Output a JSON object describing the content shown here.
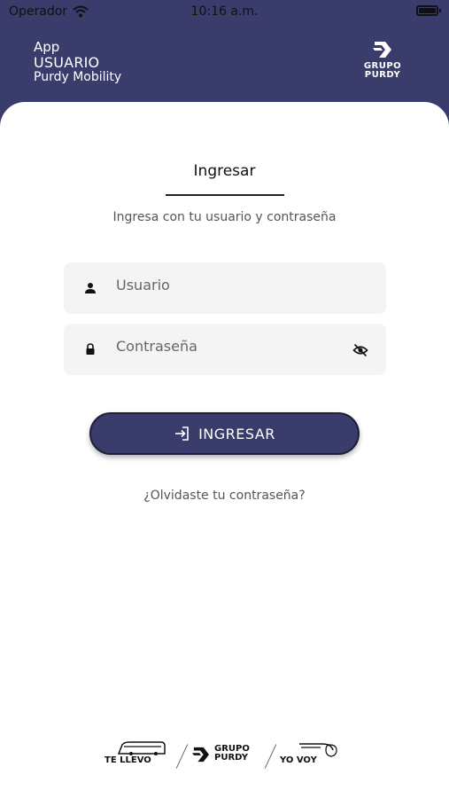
{
  "status_bar": {
    "carrier": "Operador",
    "time": "10:16 a.m."
  },
  "header": {
    "app_label": "App",
    "user_label": "USUARIO",
    "company_label": "Purdy Mobility",
    "brand_line1": "GRUPO",
    "brand_line2": "PURDY"
  },
  "login": {
    "title": "Ingresar",
    "subtitle": "Ingresa con tu usuario y contraseña",
    "username_placeholder": "Usuario",
    "password_placeholder": "Contraseña",
    "submit_label": "INGRESAR",
    "forgot_label": "¿Olvidaste tu contraseña?"
  },
  "footer": {
    "logo1": "TE LLEVO",
    "logo2_line1": "GRUPO",
    "logo2_line2": "PURDY",
    "logo3": "YO VOY"
  },
  "colors": {
    "header_bg": "#3a3c6c",
    "button_bg": "#3a3c6c",
    "field_bg": "#f4f4f4"
  }
}
